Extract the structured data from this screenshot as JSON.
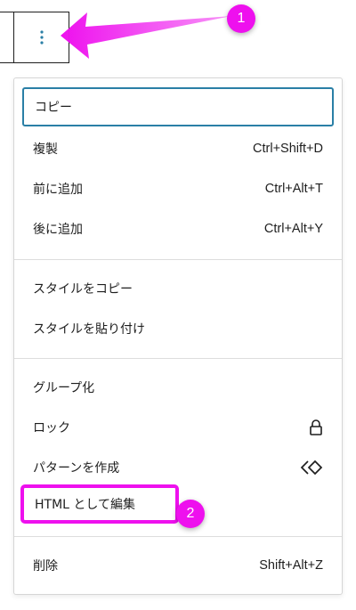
{
  "annotations": {
    "badge1": "1",
    "badge2": "2",
    "accent": "#ee10ee"
  },
  "toolbar": {
    "more_icon": "more-vertical-icon"
  },
  "menu": {
    "sections": [
      {
        "items": [
          {
            "label": "コピー",
            "shortcut": ""
          },
          {
            "label": "複製",
            "shortcut": "Ctrl+Shift+D"
          },
          {
            "label": "前に追加",
            "shortcut": "Ctrl+Alt+T"
          },
          {
            "label": "後に追加",
            "shortcut": "Ctrl+Alt+Y"
          }
        ]
      },
      {
        "items": [
          {
            "label": "スタイルをコピー",
            "shortcut": ""
          },
          {
            "label": "スタイルを貼り付け",
            "shortcut": ""
          }
        ]
      },
      {
        "items": [
          {
            "label": "グループ化",
            "shortcut": ""
          },
          {
            "label": "ロック",
            "icon": "lock-icon"
          },
          {
            "label": "パターンを作成",
            "icon": "symbol-icon"
          },
          {
            "label": "HTML として編集",
            "shortcut": ""
          }
        ]
      },
      {
        "items": [
          {
            "label": "削除",
            "shortcut": "Shift+Alt+Z"
          }
        ]
      }
    ]
  }
}
